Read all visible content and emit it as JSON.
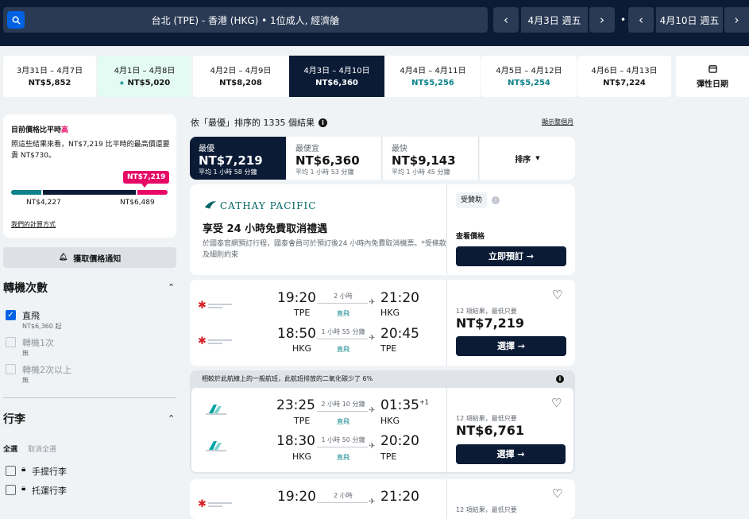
{
  "search": {
    "summary": "台北 (TPE) - 香港 (HKG)  •  1位成人, 經濟艙"
  },
  "outbound": {
    "date": "4月3日 週五"
  },
  "inbound": {
    "date": "4月10日 週五"
  },
  "date_strip": [
    {
      "range": "3月31日 – 4月7日",
      "price": "NT$5,852"
    },
    {
      "range": "4月1日 – 4月8日",
      "price": "NT$5,020",
      "star": "★"
    },
    {
      "range": "4月2日 – 4月9日",
      "price": "NT$8,208"
    },
    {
      "range": "4月3日 – 4月10日",
      "price": "NT$6,360"
    },
    {
      "range": "4月4日 – 4月11日",
      "price": "NT$5,256"
    },
    {
      "range": "4月5日 – 4月12日",
      "price": "NT$5,254"
    },
    {
      "range": "4月6日 – 4月13日",
      "price": "NT$7,224"
    }
  ],
  "flex_dates": {
    "label": "彈性日期"
  },
  "price_insight": {
    "title_prefix": "目前價格比平時",
    "title_level": "高",
    "body": "照這些結果來看，NT$7,219 比平時的最高價還要貴 NT$730。",
    "marker_price": "NT$7,219",
    "low_label": "NT$4,227",
    "high_label": "NT$6,489",
    "how_link": "我們的計算方式"
  },
  "alert_button": {
    "label": "獲取價格通知"
  },
  "stops": {
    "title": "轉機次數",
    "options": [
      {
        "label": "直飛",
        "sub": "NT$6,360 起",
        "checked": true
      },
      {
        "label": "轉機1次",
        "sub": "無",
        "checked": false
      },
      {
        "label": "轉機2次以上",
        "sub": "無",
        "checked": false
      }
    ]
  },
  "baggage": {
    "title": "行李",
    "select_all": "全選",
    "clear_all": "取消全選",
    "options": [
      {
        "label": "手提行李"
      },
      {
        "label": "托運行李"
      }
    ]
  },
  "results_header": {
    "text": "依「最優」排序的 1335 個結果",
    "month_link": "顯示整個月"
  },
  "sort_tabs": [
    {
      "label": "最優",
      "price": "NT$7,219",
      "sub": "平均 1 小時 58 分鐘"
    },
    {
      "label": "最便宜",
      "price": "NT$6,360",
      "sub": "平均 1 小時 53 分鐘"
    },
    {
      "label": "最快",
      "price": "NT$9,143",
      "sub": "平均 1 小時 45 分鐘"
    },
    {
      "label": "排序"
    }
  ],
  "ad": {
    "brand": "CATHAY PACIFIC",
    "sponsored": "受贊助",
    "headline": "享受 24 小時免費取消禮遇",
    "body": "於國泰官網預訂行程，國泰會員可於預訂後24 小時內免費取消機票。*受條款及細則約束",
    "view_price": "查看價格",
    "cta": "立即預訂 →"
  },
  "results": [
    {
      "legs": [
        {
          "dep": "19:20",
          "from": "TPE",
          "dur": "2 小時",
          "type": "直飛",
          "arr": "21:20",
          "to": "HKG",
          "plus": ""
        },
        {
          "dep": "18:50",
          "from": "HKG",
          "dur": "1 小時 55 分鐘",
          "type": "直飛",
          "arr": "20:45",
          "to": "TPE",
          "plus": ""
        }
      ],
      "deals": "12 項結果，最低只要",
      "price": "NT$7,219",
      "select": "選擇 →"
    },
    {
      "eco_note": "相較於此航線上的一般航班，此航班排放的二氧化碳少了 6%",
      "legs": [
        {
          "dep": "23:25",
          "from": "TPE",
          "dur": "2 小時 10 分鐘",
          "type": "直飛",
          "arr": "01:35",
          "to": "HKG",
          "plus": "+1"
        },
        {
          "dep": "18:30",
          "from": "HKG",
          "dur": "1 小時 50 分鐘",
          "type": "直飛",
          "arr": "20:20",
          "to": "TPE",
          "plus": ""
        }
      ],
      "deals": "12 項結果，最低只要",
      "price": "NT$6,761",
      "select": "選擇 →"
    },
    {
      "legs": [
        {
          "dep": "19:20",
          "from": "TPE",
          "dur": "2 小時",
          "type": "直飛",
          "arr": "21:20",
          "to": "HKG",
          "plus": ""
        }
      ],
      "deals": "12 項結果，最低只要"
    }
  ],
  "colors": {
    "navy": "#0b1b36",
    "blue": "#0062e3",
    "teal": "#0c838a",
    "pink": "#e70866"
  }
}
